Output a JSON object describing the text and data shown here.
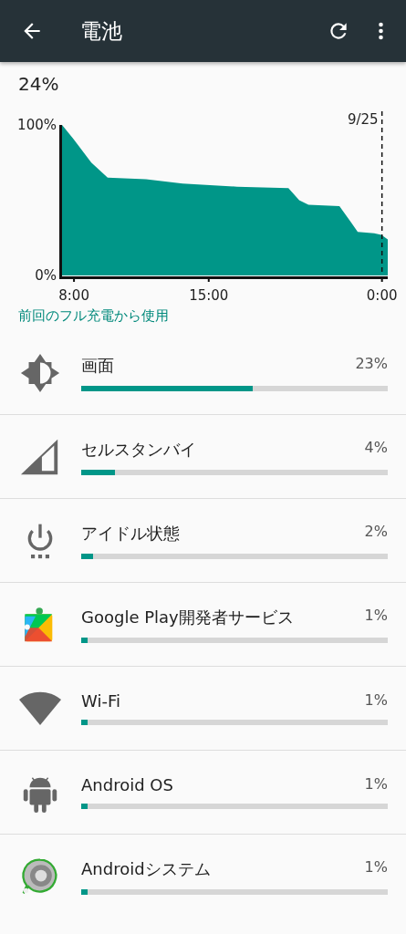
{
  "app_bar": {
    "title": "電池"
  },
  "battery": {
    "percent": "24%",
    "chart_data": {
      "type": "area",
      "x": [
        7.38,
        7.95,
        8.9,
        9.75,
        11.74,
        13.64,
        16.48,
        19.14,
        19.7,
        20.18,
        21.79,
        22.41,
        22.74,
        23.59,
        23.97,
        24.3
      ],
      "series": [
        {
          "color": "#009688",
          "values": [
            100,
            91,
            75,
            65,
            64,
            61,
            59,
            58,
            50,
            47,
            46,
            35,
            29,
            28,
            27,
            24
          ]
        }
      ],
      "ylim": [
        0,
        100
      ],
      "xlim": [
        7.38,
        24.3
      ],
      "yticks": [
        {
          "value": 0,
          "label": "0%"
        },
        {
          "value": 100,
          "label": "100%"
        }
      ],
      "xticks": [
        {
          "value": 8,
          "label": "8:00"
        },
        {
          "value": 15,
          "label": "15:00"
        },
        {
          "value": 24,
          "label": "0:00"
        }
      ],
      "annotations": [
        "9/25"
      ]
    }
  },
  "section_title": "前回のフル充電から使用",
  "usage": [
    {
      "kind": "brightness",
      "name": "画面",
      "percent": "23%",
      "level": 0.56
    },
    {
      "kind": "cell",
      "name": "セルスタンバイ",
      "percent": "4%",
      "level": 0.11
    },
    {
      "kind": "idle",
      "name": "アイドル状態",
      "percent": "2%",
      "level": 0.04
    },
    {
      "kind": "play",
      "name": "Google Play開発者サービス",
      "percent": "1%",
      "level": 0.02
    },
    {
      "kind": "wifi",
      "name": "Wi-Fi",
      "percent": "1%",
      "level": 0.02
    },
    {
      "kind": "android",
      "name": "Android OS",
      "percent": "1%",
      "level": 0.02
    },
    {
      "kind": "system",
      "name": "Androidシステム",
      "percent": "1%",
      "level": 0.02
    }
  ]
}
